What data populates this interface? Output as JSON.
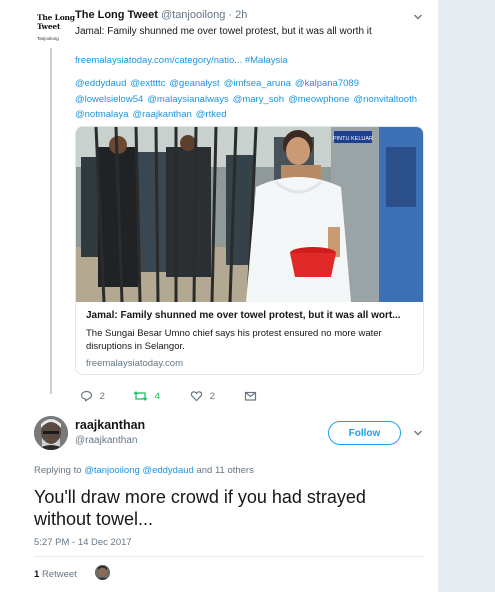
{
  "parent_tweet": {
    "avatar_logo_text": [
      "The Long",
      "Tweet"
    ],
    "avatar_logo_sub": "Tanjoolong",
    "name": "The Long Tweet",
    "handle": "@tanjooilong",
    "separator": "·",
    "time": "2h",
    "text": "Jamal: Family shunned me over towel protest, but it was all worth it",
    "link": "freemalaysiatoday.com/category/natio...",
    "hashtag": "#Malaysia",
    "mentions": [
      "@eddydaud",
      "@exttttc",
      "@geanalyst",
      "@imfsea_aruna",
      "@kalpana7089",
      "@lowelsielow54",
      "@malaysianalways",
      "@mary_soh",
      "@meowphone",
      "@nonvitaltooth",
      "@notmalaya",
      "@raajkanthan",
      "@rtked"
    ],
    "card": {
      "photo_sign_text": "PINTU KELUAR",
      "title": "Jamal: Family shunned me over towel protest, but it was all wort...",
      "description": "The Sungai Besar Umno chief says his protest ensured no more water disruptions in Selangor.",
      "domain": "freemalaysiatoday.com"
    },
    "actions": {
      "reply_icon": "reply-icon",
      "reply_count": "2",
      "retweet_icon": "retweet-icon",
      "retweet_count": "4",
      "like_icon": "heart-icon",
      "like_count": "2",
      "message_icon": "envelope-icon"
    }
  },
  "main_tweet": {
    "name": "raajkanthan",
    "handle": "@raajkanthan",
    "follow_label": "Follow",
    "replying_prefix": "Replying to",
    "replying_to": [
      "@tanjooilong",
      "@eddydaud"
    ],
    "replying_suffix": "and 11 others",
    "text": "You'll draw more crowd if you had strayed without towel...",
    "timestamp": "5:27 PM - 14 Dec 2017",
    "retweet_count": "1",
    "retweet_label": "Retweet"
  },
  "colors": {
    "link": "#1b95e0",
    "follow": "#1da1f2",
    "muted": "#657786",
    "retweet_active": "#17bf63",
    "background": "#e6ecf0"
  }
}
